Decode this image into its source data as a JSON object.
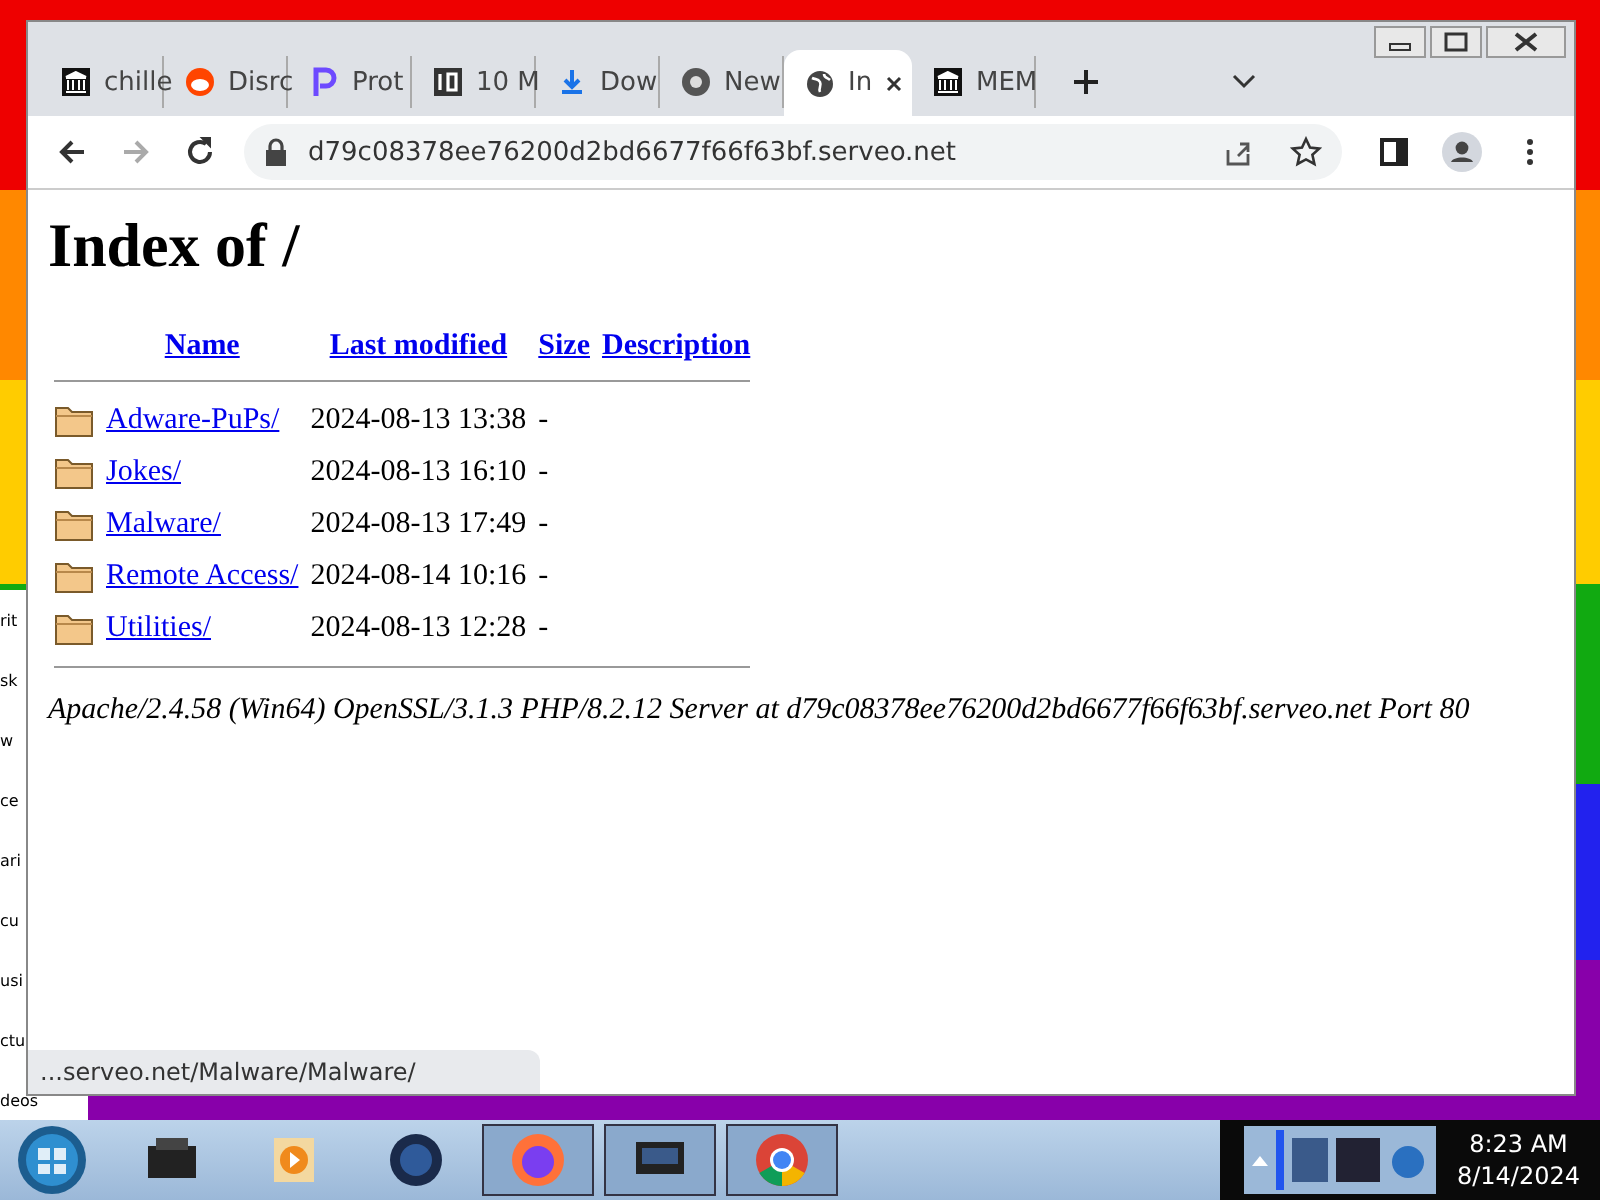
{
  "background_window": {
    "fragments": [
      "rit",
      "sk",
      "w",
      "ce",
      "ari",
      "cu",
      "usi",
      "ctu",
      "deos"
    ]
  },
  "tabs": [
    {
      "title": "chille",
      "kind": "bank",
      "selected": false
    },
    {
      "title": "Disrc",
      "kind": "robot",
      "selected": false
    },
    {
      "title": "Prot",
      "kind": "p",
      "selected": false
    },
    {
      "title": "10 M",
      "kind": "ten",
      "selected": false
    },
    {
      "title": "Dow",
      "kind": "download",
      "selected": false
    },
    {
      "title": "New",
      "kind": "chrome",
      "selected": false
    },
    {
      "title": "In",
      "kind": "globe",
      "selected": true
    },
    {
      "title": "MEM",
      "kind": "bank",
      "selected": false
    }
  ],
  "address_bar": {
    "url": "d79c08378ee76200d2bd6677f66f63bf.serveo.net"
  },
  "page": {
    "heading": "Index of /",
    "columns": [
      "Name",
      "Last modified",
      "Size",
      "Description"
    ],
    "rows": [
      {
        "name": "Adware-PuPs/",
        "modified": "2024-08-13 13:38",
        "size": "-"
      },
      {
        "name": "Jokes/",
        "modified": "2024-08-13 16:10",
        "size": "-"
      },
      {
        "name": "Malware/",
        "modified": "2024-08-13 17:49",
        "size": "-"
      },
      {
        "name": "Remote Access/",
        "modified": "2024-08-14 10:16",
        "size": "-"
      },
      {
        "name": "Utilities/",
        "modified": "2024-08-13 12:28",
        "size": "-"
      }
    ],
    "address": "Apache/2.4.58 (Win64) OpenSSL/3.1.3 PHP/8.2.12 Server at d79c08378ee76200d2bd6677f66f63bf.serveo.net Port 80"
  },
  "status_bubble": "...serveo.net/Malware/Malware/",
  "taskbar": {
    "apps": [
      {
        "kind": "printer",
        "selected": false
      },
      {
        "kind": "media",
        "selected": false
      },
      {
        "kind": "orb",
        "selected": false
      },
      {
        "kind": "firefox",
        "selected": true
      },
      {
        "kind": "monitor",
        "selected": true
      },
      {
        "kind": "chrome",
        "selected": true
      }
    ],
    "time": "8:23 AM",
    "date": "8/14/2024"
  }
}
